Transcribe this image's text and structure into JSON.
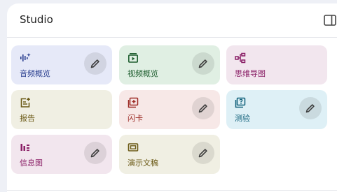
{
  "panel": {
    "title": "Studio"
  },
  "tiles": [
    {
      "label": "音频概览",
      "icon": "audio-waveform-icon",
      "bg": "#e6e9f8",
      "fg": "#2a3f8f",
      "editable": true
    },
    {
      "label": "视频概览",
      "icon": "video-icon",
      "bg": "#e0efe3",
      "fg": "#1f5f30",
      "editable": true
    },
    {
      "label": "思维导图",
      "icon": "mind-map-icon",
      "bg": "#f2e6ee",
      "fg": "#8a1f66",
      "editable": false
    },
    {
      "label": "报告",
      "icon": "report-icon",
      "bg": "#f0efe3",
      "fg": "#6b5a16",
      "editable": false
    },
    {
      "label": "闪卡",
      "icon": "flashcard-icon",
      "bg": "#f7e8e7",
      "fg": "#9c2a24",
      "editable": true
    },
    {
      "label": "测验",
      "icon": "quiz-icon",
      "bg": "#def0f6",
      "fg": "#10607a",
      "editable": true
    },
    {
      "label": "信息图",
      "icon": "infographic-icon",
      "bg": "#f2e6ee",
      "fg": "#8a1f66",
      "editable": true
    },
    {
      "label": "演示文稿",
      "icon": "slides-icon",
      "bg": "#f0efe3",
      "fg": "#6b5a16",
      "editable": true
    }
  ]
}
